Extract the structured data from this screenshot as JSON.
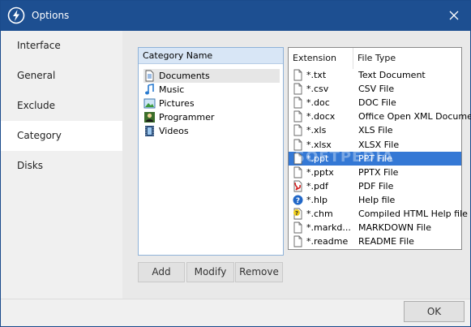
{
  "window": {
    "title": "Options"
  },
  "sidebar": {
    "items": [
      {
        "label": "Interface"
      },
      {
        "label": "General"
      },
      {
        "label": "Exclude"
      },
      {
        "label": "Category",
        "active": true
      },
      {
        "label": "Disks"
      }
    ]
  },
  "categories": {
    "header": "Category Name",
    "items": [
      {
        "label": "Documents",
        "icon": "document-icon",
        "selected": true
      },
      {
        "label": "Music",
        "icon": "music-note-icon"
      },
      {
        "label": "Pictures",
        "icon": "picture-icon"
      },
      {
        "label": "Programmer",
        "icon": "programmer-icon"
      },
      {
        "label": "Videos",
        "icon": "film-icon"
      }
    ]
  },
  "file_types": {
    "columns": {
      "extension": "Extension",
      "type": "File Type"
    },
    "rows": [
      {
        "ext": "*.txt",
        "type": "Text Document",
        "icon": "file-icon"
      },
      {
        "ext": "*.csv",
        "type": "CSV File",
        "icon": "file-icon"
      },
      {
        "ext": "*.doc",
        "type": "DOC File",
        "icon": "file-icon"
      },
      {
        "ext": "*.docx",
        "type": "Office Open XML Documen",
        "icon": "file-icon"
      },
      {
        "ext": "*.xls",
        "type": "XLS File",
        "icon": "file-icon"
      },
      {
        "ext": "*.xlsx",
        "type": "XLSX File",
        "icon": "file-icon"
      },
      {
        "ext": "*.ppt",
        "type": "PPT File",
        "icon": "file-icon",
        "selected": true
      },
      {
        "ext": "*.pptx",
        "type": "PPTX File",
        "icon": "file-icon"
      },
      {
        "ext": "*.pdf",
        "type": "PDF File",
        "icon": "pdf-icon"
      },
      {
        "ext": "*.hlp",
        "type": "Help file",
        "icon": "help-icon"
      },
      {
        "ext": "*.chm",
        "type": "Compiled HTML Help file",
        "icon": "chm-icon"
      },
      {
        "ext": "*.markd...",
        "type": "MARKDOWN File",
        "icon": "file-icon"
      },
      {
        "ext": "*.readme",
        "type": "README File",
        "icon": "file-icon"
      }
    ]
  },
  "buttons": {
    "add": "Add",
    "modify": "Modify",
    "remove": "Remove",
    "ok": "OK"
  },
  "watermark": "SOFTPEDIA",
  "colors": {
    "titlebar": "#1d4f91",
    "selection": "#3478d5"
  }
}
